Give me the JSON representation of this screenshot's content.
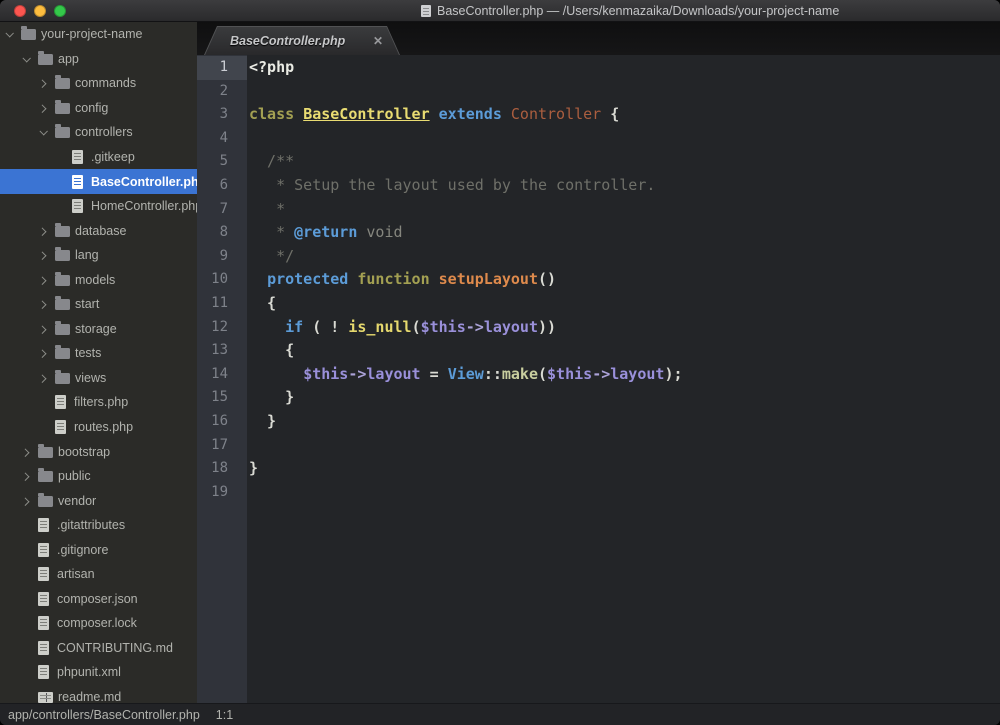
{
  "titlebar": {
    "title": "BaseController.php — /Users/kenmazaika/Downloads/your-project-name"
  },
  "traffic_lights": {
    "close": "#fc5650",
    "minimize": "#fdbd3f",
    "zoom": "#34c84a"
  },
  "tabbar": {
    "tabs": [
      {
        "label": "BaseController.php",
        "close": "✕",
        "active": true
      }
    ]
  },
  "sidebar": {
    "items": [
      {
        "label": "your-project-name",
        "kind": "folder",
        "level": 0,
        "expanded": true
      },
      {
        "label": "app",
        "kind": "folder",
        "level": 1,
        "expanded": true
      },
      {
        "label": "commands",
        "kind": "folder",
        "level": 2,
        "expanded": false
      },
      {
        "label": "config",
        "kind": "folder",
        "level": 2,
        "expanded": false
      },
      {
        "label": "controllers",
        "kind": "folder",
        "level": 2,
        "expanded": true
      },
      {
        "label": ".gitkeep",
        "kind": "file",
        "level": 3
      },
      {
        "label": "BaseController.php",
        "kind": "file",
        "level": 3,
        "selected": true
      },
      {
        "label": "HomeController.php",
        "kind": "file",
        "level": 3
      },
      {
        "label": "database",
        "kind": "folder",
        "level": 2,
        "expanded": false
      },
      {
        "label": "lang",
        "kind": "folder",
        "level": 2,
        "expanded": false
      },
      {
        "label": "models",
        "kind": "folder",
        "level": 2,
        "expanded": false
      },
      {
        "label": "start",
        "kind": "folder",
        "level": 2,
        "expanded": false
      },
      {
        "label": "storage",
        "kind": "folder",
        "level": 2,
        "expanded": false
      },
      {
        "label": "tests",
        "kind": "folder",
        "level": 2,
        "expanded": false
      },
      {
        "label": "views",
        "kind": "folder",
        "level": 2,
        "expanded": false
      },
      {
        "label": "filters.php",
        "kind": "file",
        "level": 2
      },
      {
        "label": "routes.php",
        "kind": "file",
        "level": 2
      },
      {
        "label": "bootstrap",
        "kind": "folder",
        "level": 1,
        "expanded": false
      },
      {
        "label": "public",
        "kind": "folder",
        "level": 1,
        "expanded": false
      },
      {
        "label": "vendor",
        "kind": "folder",
        "level": 1,
        "expanded": false
      },
      {
        "label": ".gitattributes",
        "kind": "file",
        "level": 1
      },
      {
        "label": ".gitignore",
        "kind": "file",
        "level": 1
      },
      {
        "label": "artisan",
        "kind": "file",
        "level": 1
      },
      {
        "label": "composer.json",
        "kind": "file",
        "level": 1
      },
      {
        "label": "composer.lock",
        "kind": "file",
        "level": 1
      },
      {
        "label": "CONTRIBUTING.md",
        "kind": "file",
        "level": 1
      },
      {
        "label": "phpunit.xml",
        "kind": "file",
        "level": 1
      },
      {
        "label": "readme.md",
        "kind": "book",
        "level": 1
      }
    ]
  },
  "editor": {
    "active_line": 1,
    "lines": [
      {
        "n": 1,
        "t": [
          [
            "php",
            "<?php"
          ]
        ]
      },
      {
        "n": 2,
        "t": []
      },
      {
        "n": 3,
        "t": [
          [
            "st",
            "class"
          ],
          [
            "pun",
            " "
          ],
          [
            "cls",
            "BaseController"
          ],
          [
            "pun",
            " "
          ],
          [
            "kw",
            "extends"
          ],
          [
            "pun",
            " "
          ],
          [
            "icl",
            "Controller"
          ],
          [
            "pun",
            " {"
          ]
        ]
      },
      {
        "n": 4,
        "t": []
      },
      {
        "n": 5,
        "t": [
          [
            "cmt",
            "  /**"
          ]
        ]
      },
      {
        "n": 6,
        "t": [
          [
            "cmt",
            "   * Setup the layout used by the controller."
          ]
        ]
      },
      {
        "n": 7,
        "t": [
          [
            "cmt",
            "   *"
          ]
        ]
      },
      {
        "n": 8,
        "t": [
          [
            "cmt",
            "   * "
          ],
          [
            "tag",
            "@return"
          ],
          [
            "voidt",
            " void"
          ]
        ]
      },
      {
        "n": 9,
        "t": [
          [
            "cmt",
            "   */"
          ]
        ]
      },
      {
        "n": 10,
        "t": [
          [
            "pun",
            "  "
          ],
          [
            "kw",
            "protected"
          ],
          [
            "pun",
            " "
          ],
          [
            "st",
            "function"
          ],
          [
            "pun",
            " "
          ],
          [
            "fn",
            "setupLayout"
          ],
          [
            "pun",
            "()"
          ]
        ]
      },
      {
        "n": 11,
        "t": [
          [
            "pun",
            "  {"
          ]
        ]
      },
      {
        "n": 12,
        "t": [
          [
            "pun",
            "    "
          ],
          [
            "kw",
            "if"
          ],
          [
            "pun",
            " ( ! "
          ],
          [
            "fnc",
            "is_null"
          ],
          [
            "pun",
            "("
          ],
          [
            "var",
            "$this"
          ],
          [
            "arr",
            "->"
          ],
          [
            "var",
            "layout"
          ],
          [
            "pun",
            "))"
          ]
        ]
      },
      {
        "n": 13,
        "t": [
          [
            "pun",
            "    {"
          ]
        ]
      },
      {
        "n": 14,
        "t": [
          [
            "pun",
            "      "
          ],
          [
            "var",
            "$this"
          ],
          [
            "arr",
            "->"
          ],
          [
            "var",
            "layout"
          ],
          [
            "pun",
            " = "
          ],
          [
            "kw",
            "View"
          ],
          [
            "pun",
            "::"
          ],
          [
            "mth",
            "make"
          ],
          [
            "pun",
            "("
          ],
          [
            "var",
            "$this"
          ],
          [
            "arr",
            "->"
          ],
          [
            "var",
            "layout"
          ],
          [
            "pun",
            ");"
          ]
        ]
      },
      {
        "n": 15,
        "t": [
          [
            "pun",
            "    }"
          ]
        ]
      },
      {
        "n": 16,
        "t": [
          [
            "pun",
            "  }"
          ]
        ]
      },
      {
        "n": 17,
        "t": []
      },
      {
        "n": 18,
        "t": [
          [
            "pun",
            "}"
          ]
        ]
      },
      {
        "n": 19,
        "t": []
      }
    ]
  },
  "statusbar": {
    "path": "app/controllers/BaseController.php",
    "cursor": "1:1"
  },
  "colors": {
    "selection_blue": "#3b74d3",
    "editor_background": "#232528",
    "gutter_background": "#30333a",
    "sidebar_background": "#2b2b28",
    "keyword_blue": "#5c9cd8",
    "storage_olive": "#a3a052",
    "class_yellow": "#e9dc72",
    "inherited_class_rust": "#ab5e3f",
    "function_orange": "#de8a4c",
    "variable_purple": "#9a90da",
    "comment_gray": "#6f7069"
  }
}
